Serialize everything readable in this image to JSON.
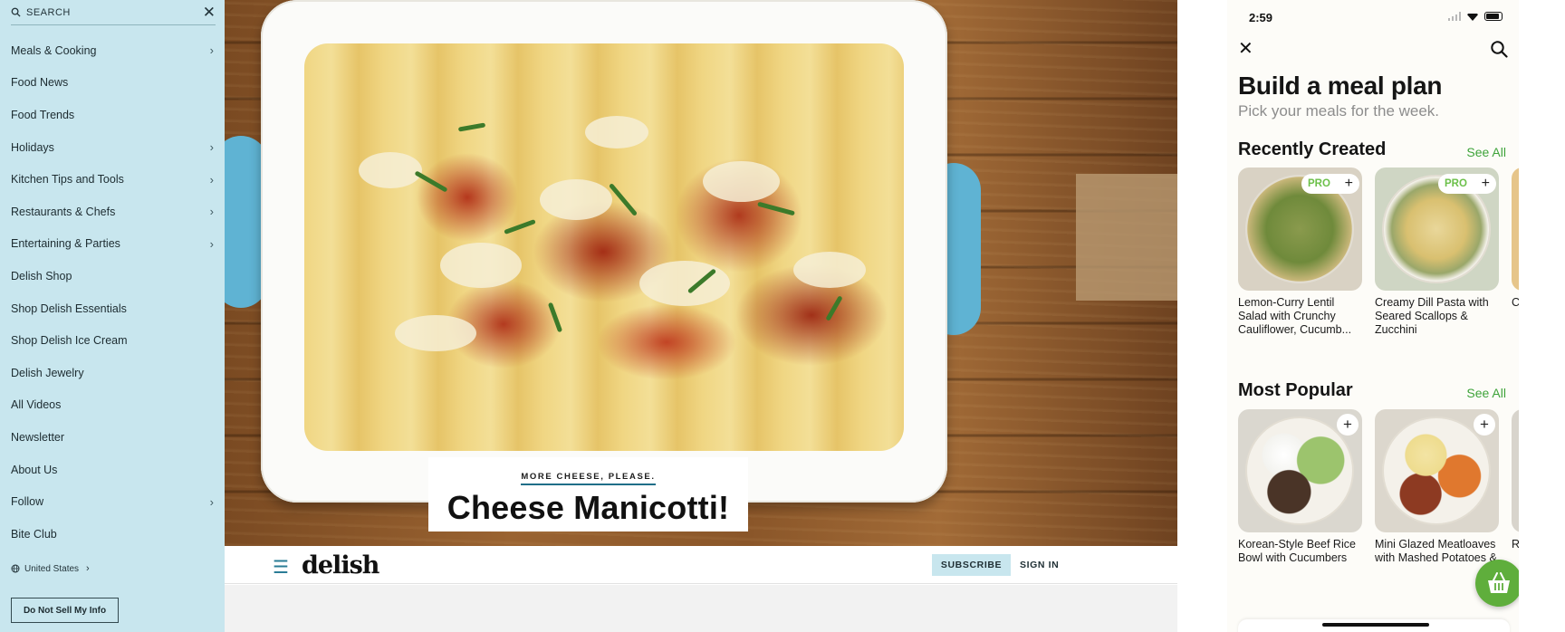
{
  "nav": {
    "search_label": "SEARCH",
    "close_glyph": "✕",
    "items": [
      {
        "label": "Meals & Cooking",
        "chevron": true
      },
      {
        "label": "Food News",
        "chevron": false
      },
      {
        "label": "Food Trends",
        "chevron": false
      },
      {
        "label": "Holidays",
        "chevron": true
      },
      {
        "label": "Kitchen Tips and Tools",
        "chevron": true
      },
      {
        "label": "Restaurants & Chefs",
        "chevron": true
      },
      {
        "label": "Entertaining & Parties",
        "chevron": true
      },
      {
        "label": "Delish Shop",
        "chevron": false
      },
      {
        "label": "Shop Delish Essentials",
        "chevron": false
      },
      {
        "label": "Shop Delish Ice Cream",
        "chevron": false
      },
      {
        "label": "Delish Jewelry",
        "chevron": false
      },
      {
        "label": "All Videos",
        "chevron": false
      },
      {
        "label": "Newsletter",
        "chevron": false
      },
      {
        "label": "About Us",
        "chevron": false
      },
      {
        "label": "Follow",
        "chevron": true
      },
      {
        "label": "Bite Club",
        "chevron": false
      }
    ],
    "region": "United States",
    "do_not_sell": "Do Not Sell My Info"
  },
  "hero": {
    "kicker": "MORE CHEESE, PLEASE.",
    "title": "Cheese Manicotti!"
  },
  "site_bar": {
    "logo": "delish",
    "subscribe": "SUBSCRIBE",
    "sign_in": "SIGN IN"
  },
  "phone": {
    "time": "2:59",
    "title": "Build a meal plan",
    "subtitle": "Pick your meals for the week.",
    "recent": {
      "heading": "Recently Created",
      "see_all": "See All",
      "badge": "PRO",
      "cards": [
        {
          "name": "Lemon-Curry Lentil Salad with Crunchy Cauliflower, Cucumb..."
        },
        {
          "name": "Creamy Dill Pasta with Seared Scallops & Zucchini"
        },
        {
          "name": "C S G"
        }
      ]
    },
    "popular": {
      "heading": "Most Popular",
      "see_all": "See All",
      "cards": [
        {
          "name": "Korean-Style Beef Rice Bowl with Cucumbers"
        },
        {
          "name": "Mini Glazed Meatloaves with Mashed Potatoes &"
        },
        {
          "name": "R A"
        }
      ]
    }
  },
  "colors": {
    "nav_bg": "#c8e6ee",
    "accent_green": "#3ea33a",
    "pro_green": "#6cc04a",
    "basket_green": "#5fae3c",
    "brand_blue": "#2a7c96"
  }
}
